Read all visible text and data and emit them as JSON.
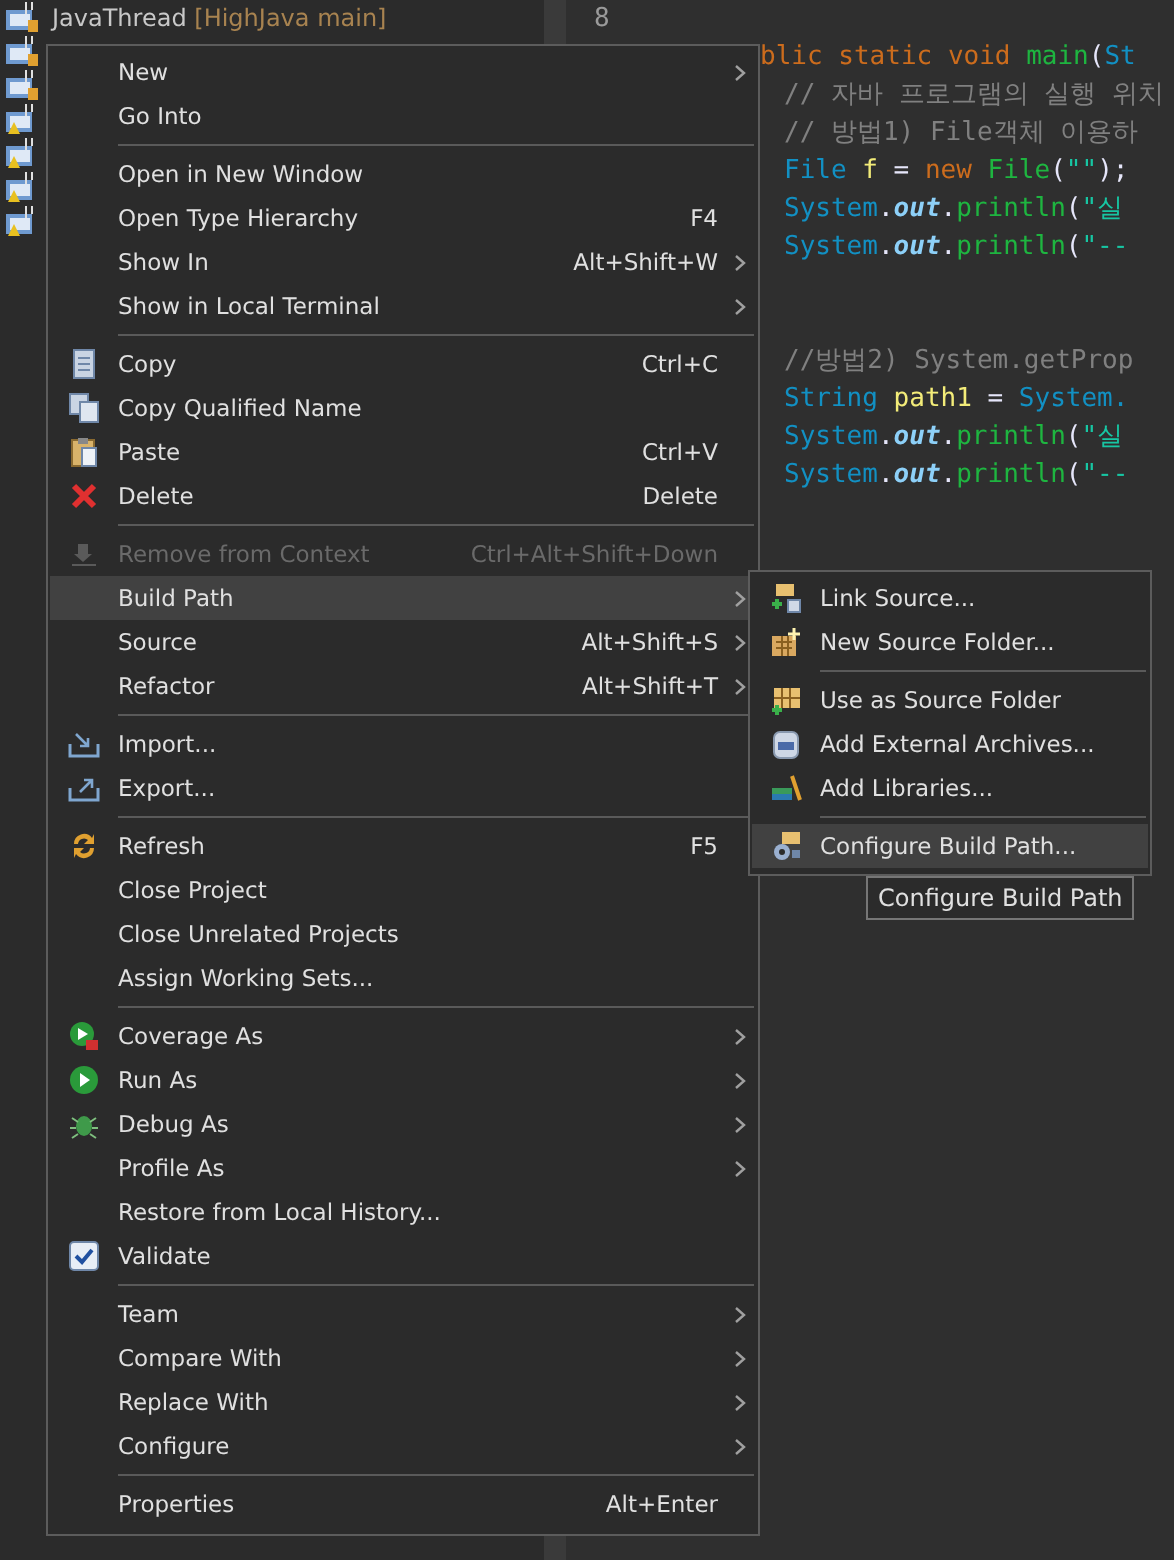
{
  "explorer": {
    "rows": [
      {
        "label": "JavaThread",
        "branch": "[HighJava main]"
      }
    ]
  },
  "editor": {
    "line_number": "8",
    "blocks": [
      [
        [
          {
            "text": "blic ",
            "kind": "keyword"
          },
          {
            "text": "static ",
            "kind": "keyword"
          },
          {
            "text": "void ",
            "kind": "keyword"
          },
          {
            "text": "main",
            "kind": "method"
          },
          {
            "text": "(",
            "kind": "plain"
          },
          {
            "text": "St",
            "kind": "type"
          }
        ],
        [
          {
            "text": "// 자바 프로그램의 실행 위치",
            "kind": "comment"
          }
        ],
        [
          {
            "text": "// 방법1) File객체 이용하",
            "kind": "comment"
          }
        ],
        [
          {
            "text": "File ",
            "kind": "type"
          },
          {
            "text": "f",
            "kind": "variable"
          },
          {
            "text": " = ",
            "kind": "plain"
          },
          {
            "text": "new ",
            "kind": "keyword"
          },
          {
            "text": "File",
            "kind": "method"
          },
          {
            "text": "(",
            "kind": "plain"
          },
          {
            "text": "\"\"",
            "kind": "string"
          },
          {
            "text": ");",
            "kind": "plain"
          }
        ],
        [
          {
            "text": "System",
            "kind": "type"
          },
          {
            "text": ".",
            "kind": "plain"
          },
          {
            "text": "out",
            "kind": "field"
          },
          {
            "text": ".",
            "kind": "plain"
          },
          {
            "text": "println",
            "kind": "method"
          },
          {
            "text": "(",
            "kind": "plain"
          },
          {
            "text": "\"실",
            "kind": "string"
          }
        ],
        [
          {
            "text": "System",
            "kind": "type"
          },
          {
            "text": ".",
            "kind": "plain"
          },
          {
            "text": "out",
            "kind": "field"
          },
          {
            "text": ".",
            "kind": "plain"
          },
          {
            "text": "println",
            "kind": "method"
          },
          {
            "text": "(",
            "kind": "plain"
          },
          {
            "text": "\"--",
            "kind": "string"
          }
        ]
      ],
      [
        [
          {
            "text": "//방법2) System.getProp",
            "kind": "comment"
          }
        ],
        [
          {
            "text": "String ",
            "kind": "type"
          },
          {
            "text": "path1",
            "kind": "variable"
          },
          {
            "text": " = ",
            "kind": "plain"
          },
          {
            "text": "System.",
            "kind": "type"
          }
        ],
        [
          {
            "text": "System",
            "kind": "type"
          },
          {
            "text": ".",
            "kind": "plain"
          },
          {
            "text": "out",
            "kind": "field"
          },
          {
            "text": ".",
            "kind": "plain"
          },
          {
            "text": "println",
            "kind": "method"
          },
          {
            "text": "(",
            "kind": "plain"
          },
          {
            "text": "\"실",
            "kind": "string"
          }
        ],
        [
          {
            "text": "System",
            "kind": "type"
          },
          {
            "text": ".",
            "kind": "plain"
          },
          {
            "text": "out",
            "kind": "field"
          },
          {
            "text": ".",
            "kind": "plain"
          },
          {
            "text": "println",
            "kind": "method"
          },
          {
            "text": "(",
            "kind": "plain"
          },
          {
            "text": "\"--",
            "kind": "string"
          }
        ]
      ]
    ]
  },
  "context_menu": {
    "items": [
      {
        "kind": "item",
        "label": "New",
        "submenu": true,
        "disabled": false,
        "selected": false
      },
      {
        "kind": "item",
        "label": "Go Into",
        "submenu": false,
        "disabled": false,
        "selected": false
      },
      {
        "kind": "separator"
      },
      {
        "kind": "item",
        "label": "Open in New Window",
        "submenu": false,
        "disabled": false,
        "selected": false
      },
      {
        "kind": "item",
        "label": "Open Type Hierarchy",
        "shortcut": "F4",
        "submenu": false,
        "disabled": false,
        "selected": false
      },
      {
        "kind": "item",
        "label": "Show In",
        "shortcut": "Alt+Shift+W",
        "submenu": true,
        "disabled": false,
        "selected": false
      },
      {
        "kind": "item",
        "label": "Show in Local Terminal",
        "submenu": true,
        "disabled": false,
        "selected": false
      },
      {
        "kind": "separator"
      },
      {
        "kind": "item",
        "label": "Copy",
        "shortcut": "Ctrl+C",
        "submenu": false,
        "disabled": false,
        "selected": false
      },
      {
        "kind": "item",
        "label": "Copy Qualified Name",
        "submenu": false,
        "disabled": false,
        "selected": false
      },
      {
        "kind": "item",
        "label": "Paste",
        "shortcut": "Ctrl+V",
        "submenu": false,
        "disabled": false,
        "selected": false
      },
      {
        "kind": "item",
        "label": "Delete",
        "shortcut": "Delete",
        "submenu": false,
        "disabled": false,
        "selected": false
      },
      {
        "kind": "separator"
      },
      {
        "kind": "item",
        "label": "Remove from Context",
        "shortcut": "Ctrl+Alt+Shift+Down",
        "submenu": false,
        "disabled": true,
        "selected": false
      },
      {
        "kind": "item",
        "label": "Build Path",
        "submenu": true,
        "disabled": false,
        "selected": true
      },
      {
        "kind": "item",
        "label": "Source",
        "shortcut": "Alt+Shift+S",
        "submenu": true,
        "disabled": false,
        "selected": false
      },
      {
        "kind": "item",
        "label": "Refactor",
        "shortcut": "Alt+Shift+T",
        "submenu": true,
        "disabled": false,
        "selected": false
      },
      {
        "kind": "separator"
      },
      {
        "kind": "item",
        "label": "Import...",
        "submenu": false,
        "disabled": false,
        "selected": false
      },
      {
        "kind": "item",
        "label": "Export...",
        "submenu": false,
        "disabled": false,
        "selected": false
      },
      {
        "kind": "separator"
      },
      {
        "kind": "item",
        "label": "Refresh",
        "shortcut": "F5",
        "submenu": false,
        "disabled": false,
        "selected": false
      },
      {
        "kind": "item",
        "label": "Close Project",
        "submenu": false,
        "disabled": false,
        "selected": false
      },
      {
        "kind": "item",
        "label": "Close Unrelated Projects",
        "submenu": false,
        "disabled": false,
        "selected": false
      },
      {
        "kind": "item",
        "label": "Assign Working Sets...",
        "submenu": false,
        "disabled": false,
        "selected": false
      },
      {
        "kind": "separator"
      },
      {
        "kind": "item",
        "label": "Coverage As",
        "submenu": true,
        "disabled": false,
        "selected": false
      },
      {
        "kind": "item",
        "label": "Run As",
        "submenu": true,
        "disabled": false,
        "selected": false
      },
      {
        "kind": "item",
        "label": "Debug As",
        "submenu": true,
        "disabled": false,
        "selected": false
      },
      {
        "kind": "item",
        "label": "Profile As",
        "submenu": true,
        "disabled": false,
        "selected": false
      },
      {
        "kind": "item",
        "label": "Restore from Local History...",
        "submenu": false,
        "disabled": false,
        "selected": false
      },
      {
        "kind": "item",
        "label": "Validate",
        "submenu": false,
        "disabled": false,
        "selected": false
      },
      {
        "kind": "separator"
      },
      {
        "kind": "item",
        "label": "Team",
        "submenu": true,
        "disabled": false,
        "selected": false
      },
      {
        "kind": "item",
        "label": "Compare With",
        "submenu": true,
        "disabled": false,
        "selected": false
      },
      {
        "kind": "item",
        "label": "Replace With",
        "submenu": true,
        "disabled": false,
        "selected": false
      },
      {
        "kind": "item",
        "label": "Configure",
        "submenu": true,
        "disabled": false,
        "selected": false
      },
      {
        "kind": "separator"
      },
      {
        "kind": "item",
        "label": "Properties",
        "shortcut": "Alt+Enter",
        "submenu": false,
        "disabled": false,
        "selected": false
      }
    ]
  },
  "build_path_submenu": {
    "items": [
      {
        "kind": "item",
        "label": "Link Source...",
        "selected": false
      },
      {
        "kind": "item",
        "label": "New Source Folder...",
        "selected": false
      },
      {
        "kind": "separator"
      },
      {
        "kind": "item",
        "label": "Use as Source Folder",
        "selected": false
      },
      {
        "kind": "item",
        "label": "Add External Archives...",
        "selected": false
      },
      {
        "kind": "item",
        "label": "Add Libraries...",
        "selected": false
      },
      {
        "kind": "separator"
      },
      {
        "kind": "item",
        "label": "Configure Build Path...",
        "selected": true
      }
    ]
  },
  "tooltip": {
    "text": "Configure Build Path"
  }
}
